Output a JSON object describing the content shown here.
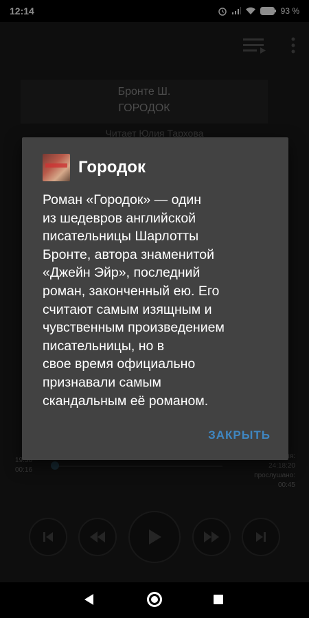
{
  "status_bar": {
    "time": "12:14",
    "battery": "93 %"
  },
  "book": {
    "author": "Бронте Ш.",
    "title": "ГОРОДОК",
    "reader": "Читает Юлия Тархова"
  },
  "player": {
    "duration_label": "19:30",
    "elapsed": "00:16",
    "total_label": "ля:",
    "total": "24:18:20",
    "listened_label": "прослушано:",
    "listened": "00:45"
  },
  "dialog": {
    "title": "Городок",
    "body_lines": [
      "Роман «Городок» — один",
      "из шедевров английской",
      "писательницы Шарлотты",
      "Бронте, автора знаменитой",
      "«Джейн Эйр», последний",
      "роман, законченный ею. Его",
      "считают самым изящным и",
      "чувственным произведением",
      "писательницы, но в",
      "свое время официально",
      "признавали самым",
      "скандальным её романом."
    ],
    "close_label": "ЗАКРЫТЬ"
  },
  "colors": {
    "accent": "#3f86c1",
    "dialog_bg": "#424242",
    "app_bg": "#1b1b1b"
  }
}
